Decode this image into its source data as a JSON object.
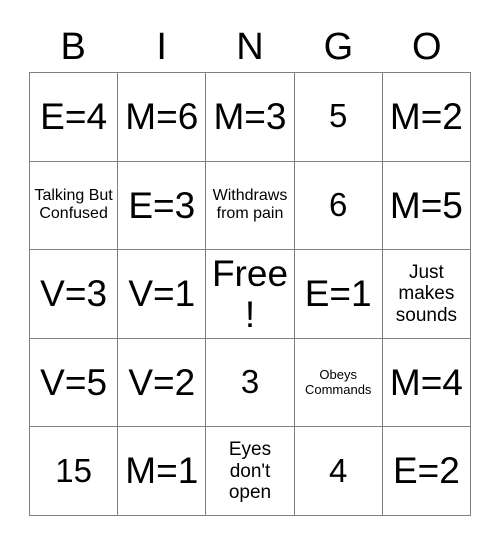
{
  "card": {
    "title": "BINGO",
    "free_space_label": "Free!",
    "border_color": "#808080",
    "text_color": "#000000",
    "background_color": "#ffffff"
  },
  "header": {
    "letters": [
      "B",
      "I",
      "N",
      "G",
      "O"
    ]
  },
  "grid": {
    "rows": 5,
    "columns": 5,
    "cells": [
      [
        {
          "text": "E=4",
          "size": "xl"
        },
        {
          "text": "M=6",
          "size": "xl"
        },
        {
          "text": "M=3",
          "size": "xl"
        },
        {
          "text": "5",
          "size": "lg"
        },
        {
          "text": "M=2",
          "size": "xl"
        }
      ],
      [
        {
          "text": "Talking But Confused",
          "size": "sm"
        },
        {
          "text": "E=3",
          "size": "xl"
        },
        {
          "text": "Withdraws from pain",
          "size": "sm"
        },
        {
          "text": "6",
          "size": "lg"
        },
        {
          "text": "M=5",
          "size": "xl"
        }
      ],
      [
        {
          "text": "V=3",
          "size": "xl"
        },
        {
          "text": "V=1",
          "size": "xl"
        },
        {
          "text": "Free!",
          "size": "xl"
        },
        {
          "text": "E=1",
          "size": "xl"
        },
        {
          "text": "Just makes sounds",
          "size": "md"
        }
      ],
      [
        {
          "text": "V=5",
          "size": "xl"
        },
        {
          "text": "V=2",
          "size": "xl"
        },
        {
          "text": "3",
          "size": "lg"
        },
        {
          "text": "Obeys Commands",
          "size": "xs"
        },
        {
          "text": "M=4",
          "size": "xl"
        }
      ],
      [
        {
          "text": "15",
          "size": "lg"
        },
        {
          "text": "M=1",
          "size": "xl"
        },
        {
          "text": "Eyes don't open",
          "size": "md"
        },
        {
          "text": "4",
          "size": "lg"
        },
        {
          "text": "E=2",
          "size": "xl"
        }
      ]
    ]
  }
}
